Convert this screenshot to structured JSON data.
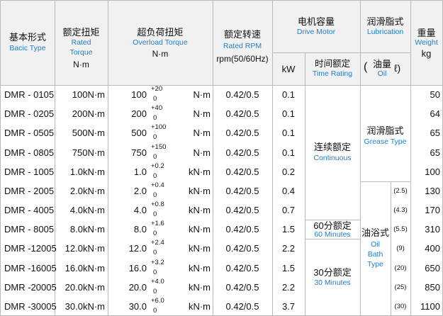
{
  "headers": {
    "model": {
      "cn": "基本形式",
      "en": "Bacic Type"
    },
    "rated_torque": {
      "cn": "额定扭矩",
      "en1": "Rated",
      "en2": "Torque",
      "unit": "N·m"
    },
    "overload_torque": {
      "cn": "超负荷扭矩",
      "en": "Overload Torque",
      "unit": "N·m"
    },
    "rated_speed": {
      "cn": "额定转速",
      "en": "Rated RPM",
      "unit": "rpm(50/60Hz)"
    },
    "drive_motor": {
      "cn": "电机容量",
      "en": "Drive Motor",
      "sub_kw": "kW",
      "sub_time_cn": "时间额定",
      "sub_time_en": "Time Rating"
    },
    "lubrication": {
      "cn": "润滑脂式",
      "en": "Lubrication",
      "sub_oil_cn": "油量",
      "sub_oil_en": "Oil",
      "paren_open": "(",
      "paren_close": "ℓ)"
    },
    "weight": {
      "cn": "重量",
      "en": "Weight",
      "unit": "kg"
    }
  },
  "rows": [
    {
      "model": "DMR -  0105",
      "rated": "100N·m",
      "ol_val": "100",
      "ol_sup": "+20",
      "ol_sub": "0",
      "ol_unit": "N·m",
      "rpm": "0.42/0.5",
      "kw": "0.1",
      "oil": "",
      "weight": "50"
    },
    {
      "model": "DMR -  0205",
      "rated": "200N·m",
      "ol_val": "200",
      "ol_sup": "+40",
      "ol_sub": "0",
      "ol_unit": "N·m",
      "rpm": "0.42/0.5",
      "kw": "0.1",
      "oil": "",
      "weight": "64"
    },
    {
      "model": "DMR -  0505",
      "rated": "500N·m",
      "ol_val": "500",
      "ol_sup": "+100",
      "ol_sub": "0",
      "ol_unit": "N·m",
      "rpm": "0.42/0.5",
      "kw": "0.1",
      "oil": "",
      "weight": "65"
    },
    {
      "model": "DMR -  0805",
      "rated": "750N·m",
      "ol_val": "750",
      "ol_sup": "+150",
      "ol_sub": "0",
      "ol_unit": "N·m",
      "rpm": "0.42/0.5",
      "kw": "0.1",
      "oil": "",
      "weight": "65"
    },
    {
      "model": "DMR -  1005",
      "rated": "1.0kN·m",
      "ol_val": "1.0",
      "ol_sup": "+0.2",
      "ol_sub": "0",
      "ol_unit": "kN·m",
      "rpm": "0.42/0.5",
      "kw": "0.2",
      "oil": "",
      "weight": "100"
    },
    {
      "model": "DMR -  2005",
      "rated": "2.0kN·m",
      "ol_val": "2.0",
      "ol_sup": "+0.4",
      "ol_sub": "0",
      "ol_unit": "kN·m",
      "rpm": "0.42/0.5",
      "kw": "0.4",
      "oil": "(2.5)",
      "weight": "130"
    },
    {
      "model": "DMR -  4005",
      "rated": "4.0kN·m",
      "ol_val": "4.0",
      "ol_sup": "+0.8",
      "ol_sub": "0",
      "ol_unit": "kN·m",
      "rpm": "0.42/0.5",
      "kw": "0.7",
      "oil": "(4.3)",
      "weight": "170"
    },
    {
      "model": "DMR -  8005",
      "rated": "8.0kN·m",
      "ol_val": "8.0",
      "ol_sup": "+1.6",
      "ol_sub": "0",
      "ol_unit": "kN·m",
      "rpm": "0.42/0.5",
      "kw": "1.5",
      "oil": "(5.5)",
      "weight": "310"
    },
    {
      "model": "DMR -12005",
      "rated": "12.0kN·m",
      "ol_val": "12.0",
      "ol_sup": "+2.4",
      "ol_sub": "0",
      "ol_unit": "kN·m",
      "rpm": "0.42/0.5",
      "kw": "2.2",
      "oil": "(9)",
      "weight": "400"
    },
    {
      "model": "DMR -16005",
      "rated": "16.0kN·m",
      "ol_val": "16.0",
      "ol_sup": "+3.2",
      "ol_sub": "0",
      "ol_unit": "kN·m",
      "rpm": "0.42/0.5",
      "kw": "1.5",
      "oil": "(20)",
      "weight": "650"
    },
    {
      "model": "DMR -20005",
      "rated": "20.0kN·m",
      "ol_val": "20.0",
      "ol_sup": "+4.0",
      "ol_sub": "0",
      "ol_unit": "kN·m",
      "rpm": "0.42/0.5",
      "kw": "2.2",
      "oil": "(25)",
      "weight": "850"
    },
    {
      "model": "DMR -30005",
      "rated": "30.0kN·m",
      "ol_val": "30.0",
      "ol_sup": "+6.0",
      "ol_sub": "0",
      "ol_unit": "kN·m",
      "rpm": "0.42/0.5",
      "kw": "3.7",
      "oil": "(30)",
      "weight": "1100"
    }
  ],
  "time_rating": {
    "continuous": {
      "cn": "连续额定",
      "en": "Continuous"
    },
    "m60": {
      "cn": "60分额定",
      "en": "60 Minutes"
    },
    "m30": {
      "cn": "30分额定",
      "en": "30 Minutes"
    }
  },
  "lub_type": {
    "grease": {
      "cn": "润滑脂式",
      "en": "Grease Type"
    },
    "oil_bath": {
      "cn": "油浴式",
      "en1": "Oil",
      "en2": "Bath",
      "en3": "Type"
    }
  },
  "colors": {
    "header_bg": "#f1f1f1",
    "border": "#b9b9b9",
    "accent": "#1e7ed0"
  }
}
